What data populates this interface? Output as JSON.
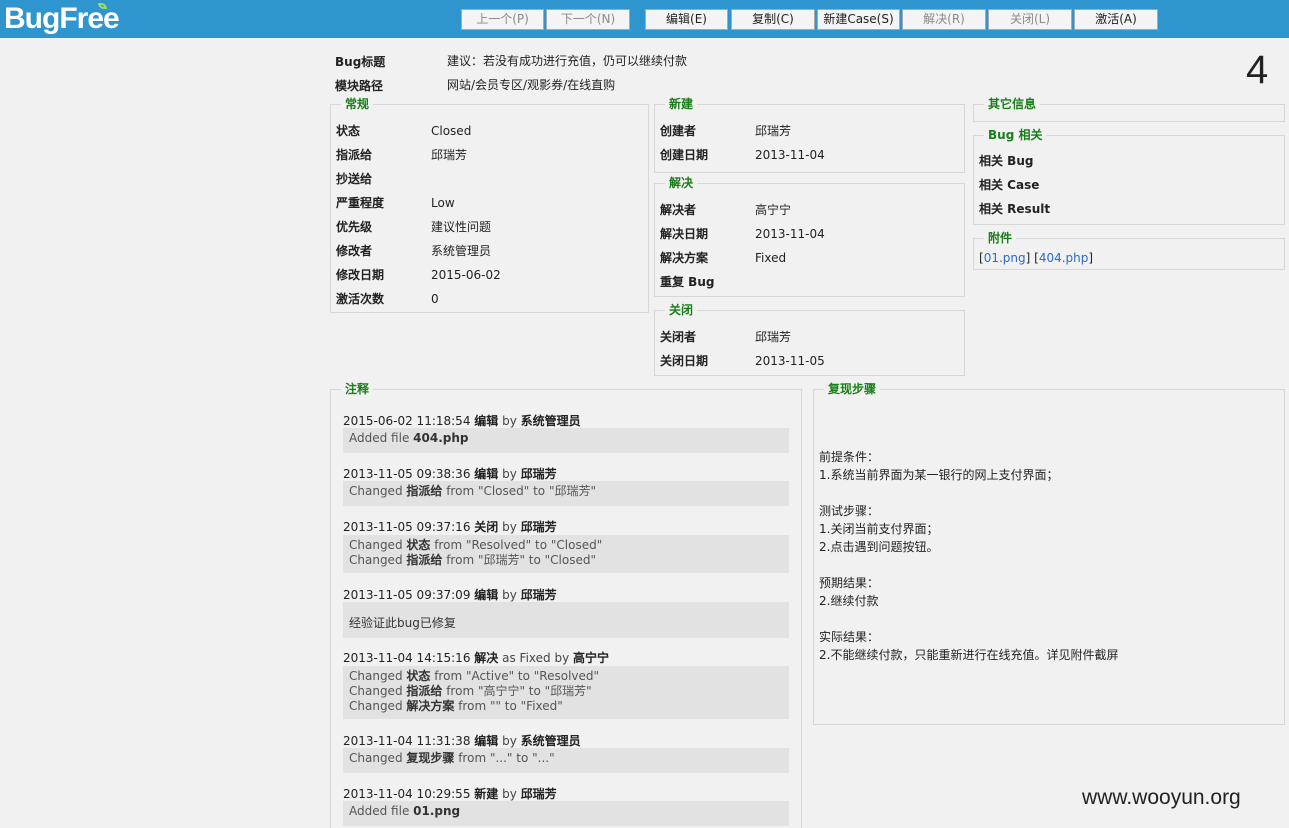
{
  "app": {
    "logo": "BugFree"
  },
  "toolbar": {
    "prev": "上一个(P)",
    "next": "下一个(N)",
    "edit": "编辑(E)",
    "copy": "复制(C)",
    "new_case": "新建Case(S)",
    "resolve": "解决(R)",
    "close": "关闭(L)",
    "activate": "激活(A)"
  },
  "bug": {
    "id": "4",
    "title_label": "Bug标题",
    "title": "建议：若没有成功进行充值，仍可以继续付款",
    "path_label": "模块路径",
    "path": "网站/会员专区/观影券/在线直购"
  },
  "general": {
    "legend": "常规",
    "fields": [
      {
        "k": "状态",
        "v": "Closed"
      },
      {
        "k": "指派给",
        "v": "邱瑞芳"
      },
      {
        "k": "抄送给",
        "v": ""
      },
      {
        "k": "严重程度",
        "v": "Low"
      },
      {
        "k": "优先级",
        "v": "建议性问题"
      },
      {
        "k": "修改者",
        "v": "系统管理员"
      },
      {
        "k": "修改日期",
        "v": "2015-06-02"
      },
      {
        "k": "激活次数",
        "v": "0"
      }
    ]
  },
  "created": {
    "legend": "新建",
    "fields": [
      {
        "k": "创建者",
        "v": "邱瑞芳"
      },
      {
        "k": "创建日期",
        "v": "2013-11-04"
      }
    ]
  },
  "resolved": {
    "legend": "解决",
    "fields": [
      {
        "k": "解决者",
        "v": "高宁宁"
      },
      {
        "k": "解决日期",
        "v": "2013-11-04"
      },
      {
        "k": "解决方案",
        "v": "Fixed"
      },
      {
        "k": "重复 Bug",
        "v": ""
      }
    ]
  },
  "closed": {
    "legend": "关闭",
    "fields": [
      {
        "k": "关闭者",
        "v": "邱瑞芳"
      },
      {
        "k": "关闭日期",
        "v": "2013-11-05"
      }
    ]
  },
  "other": {
    "legend": "其它信息"
  },
  "related": {
    "legend": "Bug 相关",
    "fields": [
      {
        "k": "相关 Bug"
      },
      {
        "k": "相关 Case"
      },
      {
        "k": "相关 Result"
      }
    ]
  },
  "attachments": {
    "legend": "附件",
    "files": [
      "01.png",
      "404.php"
    ]
  },
  "notes": {
    "legend": "注释",
    "entries": [
      {
        "time": "2015-06-02 11:18:54",
        "action": "编辑",
        "by": "by",
        "who": "系统管理员",
        "lines": [
          {
            "pre": "Added file ",
            "b": "404.php",
            "post": ""
          }
        ]
      },
      {
        "time": "2013-11-05 09:38:36",
        "action": "编辑",
        "by": "by",
        "who": "邱瑞芳",
        "lines": [
          {
            "pre": "Changed ",
            "b": "指派给",
            "post": " from \"Closed\" to \"邱瑞芳\""
          }
        ]
      },
      {
        "time": "2013-11-05 09:37:16",
        "action": "关闭",
        "by": "by",
        "who": "邱瑞芳",
        "lines": [
          {
            "pre": "Changed ",
            "b": "状态",
            "post": " from \"Resolved\" to \"Closed\""
          },
          {
            "pre": "Changed ",
            "b": "指派给",
            "post": " from \"邱瑞芳\" to \"Closed\""
          }
        ]
      },
      {
        "time": "2013-11-05 09:37:09",
        "action": "编辑",
        "by": "by",
        "who": "邱瑞芳",
        "lines": [
          {
            "pre": "经验证此bug已修复",
            "b": "",
            "post": ""
          }
        ]
      },
      {
        "time": "2013-11-04 14:15:16",
        "action": "解决",
        "by": "as Fixed by",
        "who": "高宁宁",
        "lines": [
          {
            "pre": "Changed ",
            "b": "状态",
            "post": " from \"Active\" to \"Resolved\""
          },
          {
            "pre": "Changed ",
            "b": "指派给",
            "post": " from \"高宁宁\" to \"邱瑞芳\""
          },
          {
            "pre": "Changed ",
            "b": "解决方案",
            "post": " from \"\" to \"Fixed\""
          }
        ]
      },
      {
        "time": "2013-11-04 11:31:38",
        "action": "编辑",
        "by": "by",
        "who": "系统管理员",
        "lines": [
          {
            "pre": "Changed ",
            "b": "复现步骤",
            "post": " from \"...\" to \"...\""
          }
        ]
      },
      {
        "time": "2013-11-04 10:29:55",
        "action": "新建",
        "by": "by",
        "who": "邱瑞芳",
        "lines": [
          {
            "pre": "Added file ",
            "b": "01.png",
            "post": ""
          }
        ]
      }
    ]
  },
  "steps": {
    "legend": "复现步骤",
    "text": "前提条件：\n1.系统当前界面为某一银行的网上支付界面；\n\n测试步骤：\n1.关闭当前支付界面；\n2.点击遇到问题按钮。\n\n预期结果：\n2.继续付款\n\n实际结果：\n2.不能继续付款，只能重新进行在线充值。详见附件截屏"
  },
  "watermark": "www.wooyun.org"
}
